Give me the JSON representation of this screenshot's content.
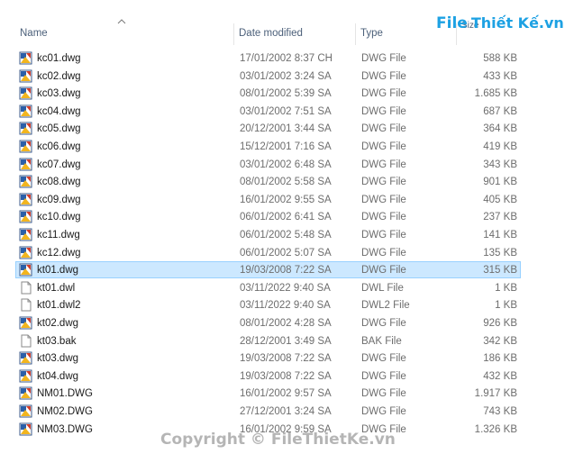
{
  "columns": {
    "name": "Name",
    "date": "Date modified",
    "type": "Type",
    "size": "Size"
  },
  "files": [
    {
      "name": "kc01.dwg",
      "date": "17/01/2002 8:37 CH",
      "type": "DWG File",
      "size": "588 KB",
      "icon": "dwg-file-icon"
    },
    {
      "name": "kc02.dwg",
      "date": "03/01/2002 3:24 SA",
      "type": "DWG File",
      "size": "433 KB",
      "icon": "dwg-file-icon"
    },
    {
      "name": "kc03.dwg",
      "date": "08/01/2002 5:39 SA",
      "type": "DWG File",
      "size": "1.685 KB",
      "icon": "dwg-file-icon"
    },
    {
      "name": "kc04.dwg",
      "date": "03/01/2002 7:51 SA",
      "type": "DWG File",
      "size": "687 KB",
      "icon": "dwg-file-icon"
    },
    {
      "name": "kc05.dwg",
      "date": "20/12/2001 3:44 SA",
      "type": "DWG File",
      "size": "364 KB",
      "icon": "dwg-file-icon"
    },
    {
      "name": "kc06.dwg",
      "date": "15/12/2001 7:16 SA",
      "type": "DWG File",
      "size": "419 KB",
      "icon": "dwg-file-icon"
    },
    {
      "name": "kc07.dwg",
      "date": "03/01/2002 6:48 SA",
      "type": "DWG File",
      "size": "343 KB",
      "icon": "dwg-file-icon"
    },
    {
      "name": "kc08.dwg",
      "date": "08/01/2002 5:58 SA",
      "type": "DWG File",
      "size": "901 KB",
      "icon": "dwg-file-icon"
    },
    {
      "name": "kc09.dwg",
      "date": "16/01/2002 9:55 SA",
      "type": "DWG File",
      "size": "405 KB",
      "icon": "dwg-file-icon"
    },
    {
      "name": "kc10.dwg",
      "date": "06/01/2002 6:41 SA",
      "type": "DWG File",
      "size": "237 KB",
      "icon": "dwg-file-icon"
    },
    {
      "name": "kc11.dwg",
      "date": "06/01/2002 5:48 SA",
      "type": "DWG File",
      "size": "141 KB",
      "icon": "dwg-file-icon"
    },
    {
      "name": "kc12.dwg",
      "date": "06/01/2002 5:07 SA",
      "type": "DWG File",
      "size": "135 KB",
      "icon": "dwg-file-icon"
    },
    {
      "name": "kt01.dwg",
      "date": "19/03/2008 7:22 SA",
      "type": "DWG File",
      "size": "315 KB",
      "icon": "dwg-file-icon",
      "selected": true
    },
    {
      "name": "kt01.dwl",
      "date": "03/11/2022 9:40 SA",
      "type": "DWL File",
      "size": "1 KB",
      "icon": "blank-file-icon"
    },
    {
      "name": "kt01.dwl2",
      "date": "03/11/2022 9:40 SA",
      "type": "DWL2 File",
      "size": "1 KB",
      "icon": "blank-file-icon"
    },
    {
      "name": "kt02.dwg",
      "date": "08/01/2002 4:28 SA",
      "type": "DWG File",
      "size": "926 KB",
      "icon": "dwg-file-icon"
    },
    {
      "name": "kt03.bak",
      "date": "28/12/2001 3:49 SA",
      "type": "BAK File",
      "size": "342 KB",
      "icon": "blank-file-icon"
    },
    {
      "name": "kt03.dwg",
      "date": "19/03/2008 7:22 SA",
      "type": "DWG File",
      "size": "186 KB",
      "icon": "dwg-file-icon"
    },
    {
      "name": "kt04.dwg",
      "date": "19/03/2008 7:22 SA",
      "type": "DWG File",
      "size": "432 KB",
      "icon": "dwg-file-icon"
    },
    {
      "name": "NM01.DWG",
      "date": "16/01/2002 9:57 SA",
      "type": "DWG File",
      "size": "1.917 KB",
      "icon": "dwg-file-icon"
    },
    {
      "name": "NM02.DWG",
      "date": "27/12/2001 3:24 SA",
      "type": "DWG File",
      "size": "743 KB",
      "icon": "dwg-file-icon"
    },
    {
      "name": "NM03.DWG",
      "date": "16/01/2002 9:59 SA",
      "type": "DWG File",
      "size": "1.326 KB",
      "icon": "dwg-file-icon"
    }
  ],
  "logo": {
    "prefix": "File",
    "rest": "Thiết Kế.vn"
  },
  "watermark": "Copyright © FileThietKe.vn"
}
